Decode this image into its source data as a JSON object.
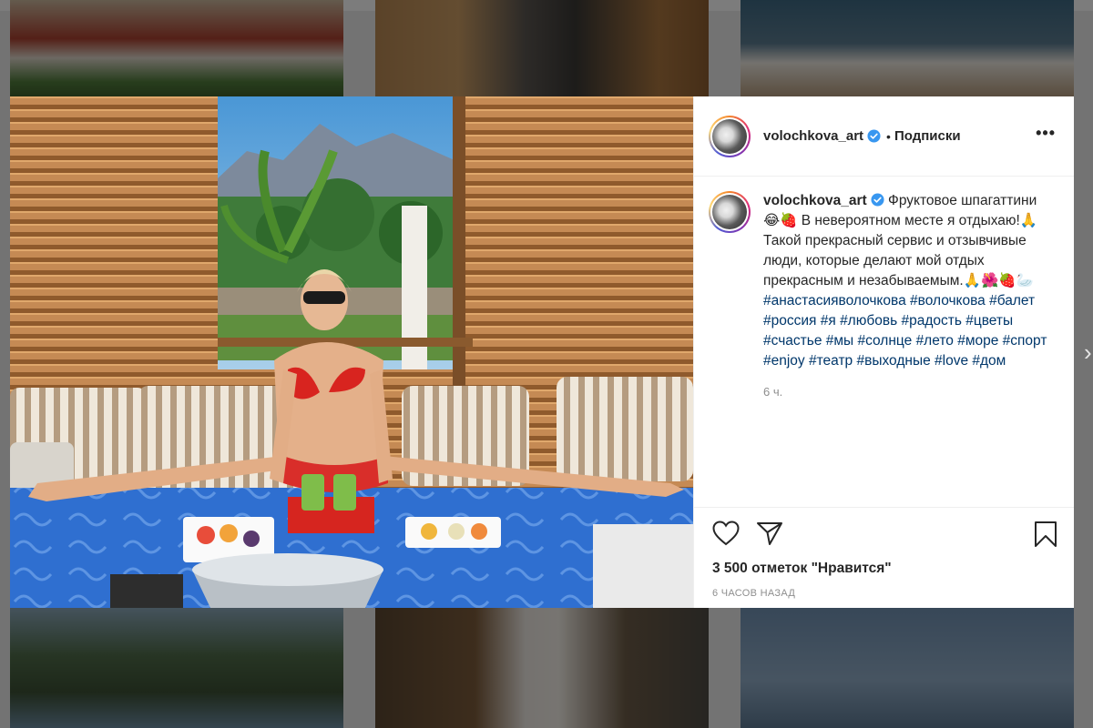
{
  "post": {
    "username": "volochkova_art",
    "separator": "•",
    "follow_label": "Подписки",
    "more_label": "•••",
    "caption": "Фруктовое шпагаттини😂🍓 В невероятном месте я отдыхаю!🙏 Такой прекрасный сервис и отзывчивые люди, которые делают мой отдых прекрасным и незабываемым.🙏🌺🍓🦢",
    "hashtags": [
      "#анастасияволочкова",
      "#волочкова",
      "#балет",
      "#россия",
      "#я",
      "#любовь",
      "#радость",
      "#цветы",
      "#счастье",
      "#мы",
      "#солнце",
      "#лето",
      "#море",
      "#спорт",
      "#enjoy",
      "#театр",
      "#выходные",
      "#love",
      "#дом"
    ],
    "comment_time": "6 ч.",
    "likes": "3 500 отметок \"Нравится\"",
    "post_time": "6 ЧАСОВ НАЗАД"
  },
  "icons": {
    "like": "heart-icon",
    "share": "paper-plane-icon",
    "save": "bookmark-icon",
    "verified": "verified-badge-icon",
    "more": "more-options-icon",
    "next": "chevron-right-icon"
  },
  "colors": {
    "link": "#00376b",
    "text": "#262626",
    "muted": "#8e8e8e",
    "verified": "#3897f0"
  }
}
